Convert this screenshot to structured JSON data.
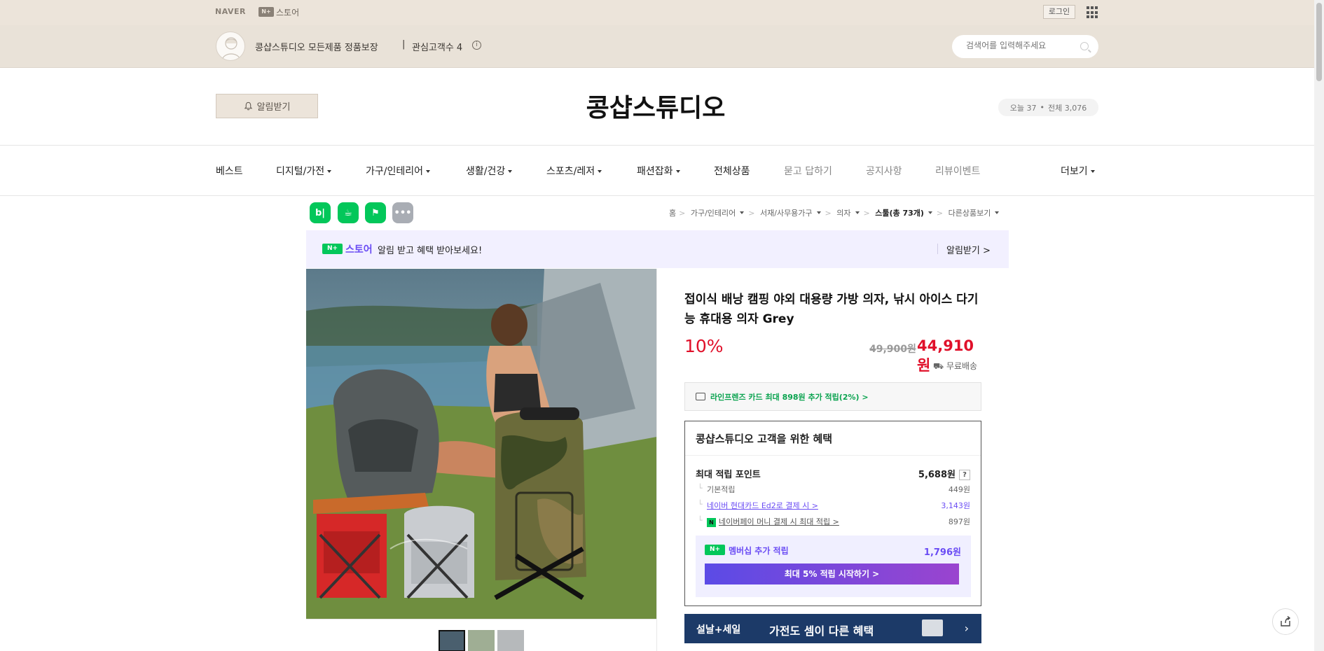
{
  "gnb": {
    "naver": "NAVER",
    "nplus": "N+",
    "store": "스토어",
    "login": "로그인"
  },
  "storebar": {
    "description": "콩샵스튜디오 모든제품 정품보장",
    "separator": "|",
    "favorites": "관심고객수 4",
    "info_icon": "i",
    "search_placeholder": "검색어를 입력해주세요"
  },
  "header": {
    "alarm_label": "알림받기",
    "store_title": "콩샵스튜디오",
    "today_label": "오늘 37",
    "dot": "•",
    "total_label": "전체 3,076"
  },
  "nav": [
    {
      "label": "베스트",
      "caret": false,
      "gray": false
    },
    {
      "label": "디지털/가전",
      "caret": true,
      "gray": false
    },
    {
      "label": "가구/인테리어",
      "caret": true,
      "gray": false
    },
    {
      "label": "생활/건강",
      "caret": true,
      "gray": false
    },
    {
      "label": "스포츠/레저",
      "caret": true,
      "gray": false
    },
    {
      "label": "패션잡화",
      "caret": true,
      "gray": false
    },
    {
      "label": "전체상품",
      "caret": false,
      "gray": false
    },
    {
      "label": "묻고 답하기",
      "caret": false,
      "gray": true
    },
    {
      "label": "공지사항",
      "caret": false,
      "gray": true
    },
    {
      "label": "리뷰이벤트",
      "caret": false,
      "gray": true
    },
    {
      "label": "더보기",
      "caret": true,
      "gray": false
    }
  ],
  "share_icons": [
    {
      "name": "blog-share-icon",
      "glyph": "b|",
      "color": "#03c75a"
    },
    {
      "name": "cafe-share-icon",
      "glyph": "☕",
      "color": "#03c75a"
    },
    {
      "name": "bookmark-share-icon",
      "glyph": "⚑",
      "color": "#03c75a"
    },
    {
      "name": "more-share-icon",
      "glyph": "•••",
      "color": "#a9adb4"
    }
  ],
  "breadcrumb": {
    "home": "홈",
    "c1": "가구/인테리어",
    "c2": "서재/사무용가구",
    "c3": "의자",
    "c4": "스툴(총 73개)",
    "other": "다른상품보기",
    "sep": ">"
  },
  "promo": {
    "nplus": "N+",
    "store": "스토어",
    "message": "알림 받고 혜택 받아보세요!",
    "action": "알림받기 >"
  },
  "product": {
    "name": "접이식 배낭 캠핑 야외 대용량 가방 의자, 낚시 아이스 다기능 휴대용 의자 Grey",
    "discount": "10%",
    "original_price": "49,900원",
    "sale_price": "44,910원",
    "shipping": "무료배송",
    "card_benefit": "라인프렌즈 카드 최대 898원 추가 적립(2%) >"
  },
  "benefit": {
    "title": "콩샵스튜디오 고객을 위한 혜택",
    "max_points_label": "최대 적립 포인트",
    "max_points_value": "5,688원",
    "help": "?",
    "basic_label": "기본적립",
    "basic_value": "449원",
    "card_label": "네이버 현대카드 Ed2로 결제 시 >",
    "card_value": "3,143원",
    "pay_label": "네이버페이 머니 결제 시 최대 적립 >",
    "pay_value": "897원",
    "membership_badge": "N+",
    "membership_label": "멤버십 추가 적립",
    "membership_value": "1,796원",
    "membership_button": "최대 5% 적립 시작하기 >"
  },
  "seolnal": {
    "left": "설날+세일",
    "main": "가전도 셈이 다른 혜택",
    "arrow": "›"
  }
}
